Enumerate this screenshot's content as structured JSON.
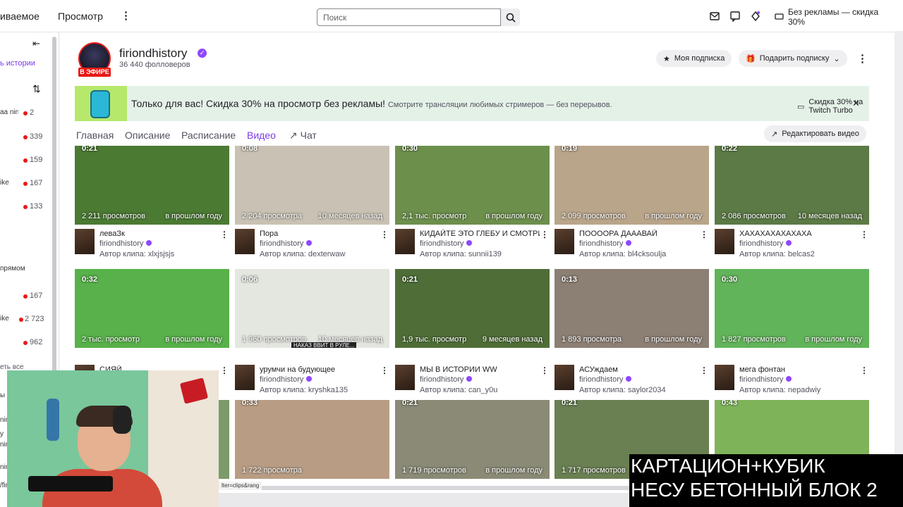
{
  "topbar": {
    "nav_following": "иваемое",
    "nav_browse": "Просмотр",
    "more": "⋮",
    "search_placeholder": "Поиск",
    "adfree_label": "Без рекламы — скидка 30%"
  },
  "sidebar": {
    "history_label": "ь истории",
    "items": [
      {
        "name": "аа ning...",
        "viewers": "2"
      },
      {
        "name": "",
        "viewers": "339"
      },
      {
        "name": "",
        "viewers": "159"
      },
      {
        "name": "ike",
        "viewers": "167"
      },
      {
        "name": "",
        "viewers": "133"
      }
    ],
    "section_label": "прямом",
    "items2": [
      {
        "name": "",
        "viewers": "167"
      },
      {
        "name": "ike",
        "viewers": "2 723"
      },
      {
        "name": "",
        "viewers": "962"
      }
    ],
    "see_all": "еть все",
    "extra_lines": [
      "ы",
      "ning",
      "y",
      "ning",
      "ning",
      "/fir"
    ]
  },
  "channel": {
    "name": "firiondhistory",
    "followers": "36 440 фолловеров",
    "live_badge": "В ЭФИРЕ",
    "my_sub_label": "Моя подписка",
    "gift_label": "Подарить подписку",
    "more": "⋮"
  },
  "promo": {
    "title": "Только для вас! Скидка 30% на просмотр без рекламы!",
    "subtitle": "Смотрите трансляции любимых стримеров — без перерывов.",
    "button": "Скидка 30% на Twitch Turbo",
    "close": "✕"
  },
  "tabs": {
    "home": "Главная",
    "about": "Описание",
    "schedule": "Расписание",
    "videos": "Видео",
    "chat": "Чат",
    "edit_video": "Редактировать видео"
  },
  "clips": [
    {
      "duration": "0:21",
      "views": "2 211 просмотров",
      "ago": "в прошлом году",
      "title": "леваЗк",
      "channel": "firiondhistory",
      "author": "Автор клипа: xlxjsjsjs",
      "bg": "#4b7a33"
    },
    {
      "duration": "0:08",
      "views": "2 204 просмотра",
      "ago": "10 месяцев назад",
      "title": "Пора",
      "channel": "firiondhistory",
      "author": "Автор клипа: dexterwaw",
      "bg": "#c9c2b4"
    },
    {
      "duration": "0:30",
      "views": "2,1 тыс. просмотр",
      "ago": "в прошлом году",
      "title": "КИДАЙТЕ ЭТО ГЛЕБУ И СМОТРИТЕ",
      "channel": "firiondhistory",
      "author": "Автор клипа: sunnii139",
      "bg": "#6d8f4c"
    },
    {
      "duration": "0:19",
      "views": "2 099 просмотров",
      "ago": "в прошлом году",
      "title": "ПООООРА ДАААВАЙ",
      "channel": "firiondhistory",
      "author": "Автор клипа: bl4cksoulja",
      "bg": "#b9a58a"
    },
    {
      "duration": "0:22",
      "views": "2 086 просмотров",
      "ago": "10 месяцев назад",
      "title": "ХАХАХАХАХАХАХА",
      "channel": "firiondhistory",
      "author": "Автор клипа: belcas2",
      "bg": "#5c7a45"
    },
    {
      "duration": "0:32",
      "views": "2 тыс. просмотр",
      "ago": "в прошлом году",
      "title": "СИЯЙ",
      "channel": "",
      "author": "",
      "bg": "#58b14a"
    },
    {
      "duration": "0:06",
      "views": "1 960 просмотров",
      "ago": "10 месяцев назад",
      "title": "урумчи на будующее",
      "channel": "firiondhistory",
      "author": "Автор клипа: kryshka135",
      "bg": "#e4e6e0"
    },
    {
      "duration": "0:21",
      "views": "1,9 тыс. просмотр",
      "ago": "9 месяцев назад",
      "title": "МЫ В ИСТОРИИ WW",
      "channel": "firiondhistory",
      "author": "Автор клипа: can_y0u",
      "bg": "#4f6e37"
    },
    {
      "duration": "0:13",
      "views": "1 893 просмотра",
      "ago": "в прошлом году",
      "title": "АСУждаем",
      "channel": "firiondhistory",
      "author": "Автор клипа: saylor2034",
      "bg": "#8c7f74"
    },
    {
      "duration": "0:30",
      "views": "1 827 просмотров",
      "ago": "в прошлом году",
      "title": "мега фонтан",
      "channel": "firiondhistory",
      "author": "Автор клипа: nepadwiy",
      "bg": "#62b45a"
    },
    {
      "duration": "",
      "views": "",
      "ago": "",
      "title": "",
      "channel": "",
      "author": "",
      "bg": "#7b9b6a"
    },
    {
      "duration": "0:33",
      "views": "1 722 просмотра",
      "ago": "",
      "title": "",
      "channel": "",
      "author": "",
      "bg": "#b89d84"
    },
    {
      "duration": "0:21",
      "views": "1 719 просмотров",
      "ago": "в прошлом году",
      "title": "",
      "channel": "",
      "author": "",
      "bg": "#8a8a76"
    },
    {
      "duration": "0:21",
      "views": "1 717 просмотров",
      "ago": "",
      "title": "",
      "channel": "",
      "author": "",
      "bg": "#6a7f52"
    },
    {
      "duration": "0:43",
      "views": "",
      "ago": "",
      "title": "",
      "channel": "",
      "author": "",
      "bg": "#7fb35a"
    }
  ],
  "thumb_overlay_text": "НАКАЗ ВВИТ В РУЛЕ...",
  "overlay": {
    "line1": "КАРТАЦИОН+КУБИК",
    "line2": "НЕСУ БЕТОННЫЙ БЛОК 2"
  },
  "url_tip": "lter=clips&rang",
  "colors": {
    "accent": "#7c3aed",
    "live": "#e91916",
    "promo_bg": "#e4f1e7"
  }
}
